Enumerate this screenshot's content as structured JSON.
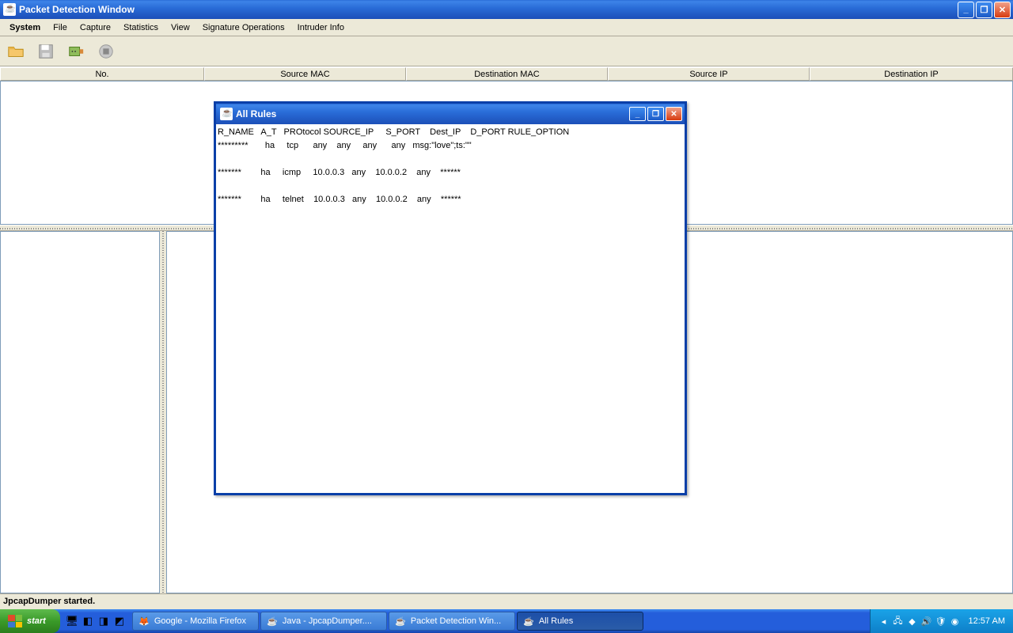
{
  "main_title": "Packet Detection Window",
  "menus": [
    "System",
    "File",
    "Capture",
    "Statistics",
    "View",
    "Signature Operations",
    "Intruder Info"
  ],
  "columns": [
    "No.",
    "Source MAC",
    "Destination MAC",
    "Source IP",
    "Destination IP"
  ],
  "status": "JpcapDumper started.",
  "dialog": {
    "title": "All Rules",
    "header": "R_NAME   A_T   PROtocol SOURCE_IP     S_PORT    Dest_IP    D_PORT RULE_OPTION",
    "rows": [
      "*********       ha     tcp      any    any     any      any   msg:\"love\";ts:\"\"",
      "",
      "*******        ha     icmp     10.0.0.3   any    10.0.0.2    any    ******",
      "",
      "*******        ha     telnet    10.0.0.3   any    10.0.0.2    any    ******"
    ]
  },
  "taskbar": {
    "start": "start",
    "items": [
      {
        "label": "Google - Mozilla Firefox",
        "icon": "firefox"
      },
      {
        "label": "Java - JpcapDumper....",
        "icon": "java"
      },
      {
        "label": "Packet Detection Win...",
        "icon": "java"
      },
      {
        "label": "All Rules",
        "icon": "java",
        "active": true
      }
    ],
    "clock": "12:57 AM"
  }
}
